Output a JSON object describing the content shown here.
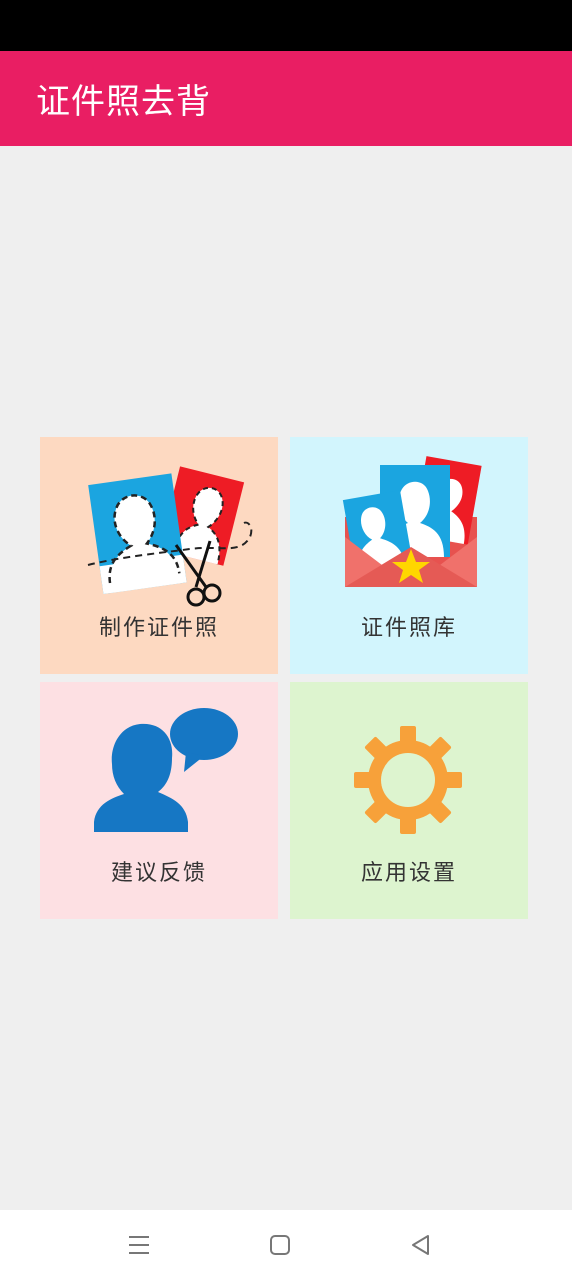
{
  "app": {
    "title": "证件照去背"
  },
  "tiles": [
    {
      "label": "制作证件照",
      "icon": "photo-cutout-icon",
      "color": "#fdd9c1"
    },
    {
      "label": "证件照库",
      "icon": "photo-library-icon",
      "color": "#d2f5fd"
    },
    {
      "label": "建议反馈",
      "icon": "feedback-icon",
      "color": "#fde0e3"
    },
    {
      "label": "应用设置",
      "icon": "gear-icon",
      "color": "#ddf4cf"
    }
  ],
  "navbar": {
    "menu_icon": "menu-icon",
    "home_icon": "home-icon",
    "back_icon": "back-icon"
  },
  "colors": {
    "accent": "#e91e63",
    "background": "#efefef"
  }
}
